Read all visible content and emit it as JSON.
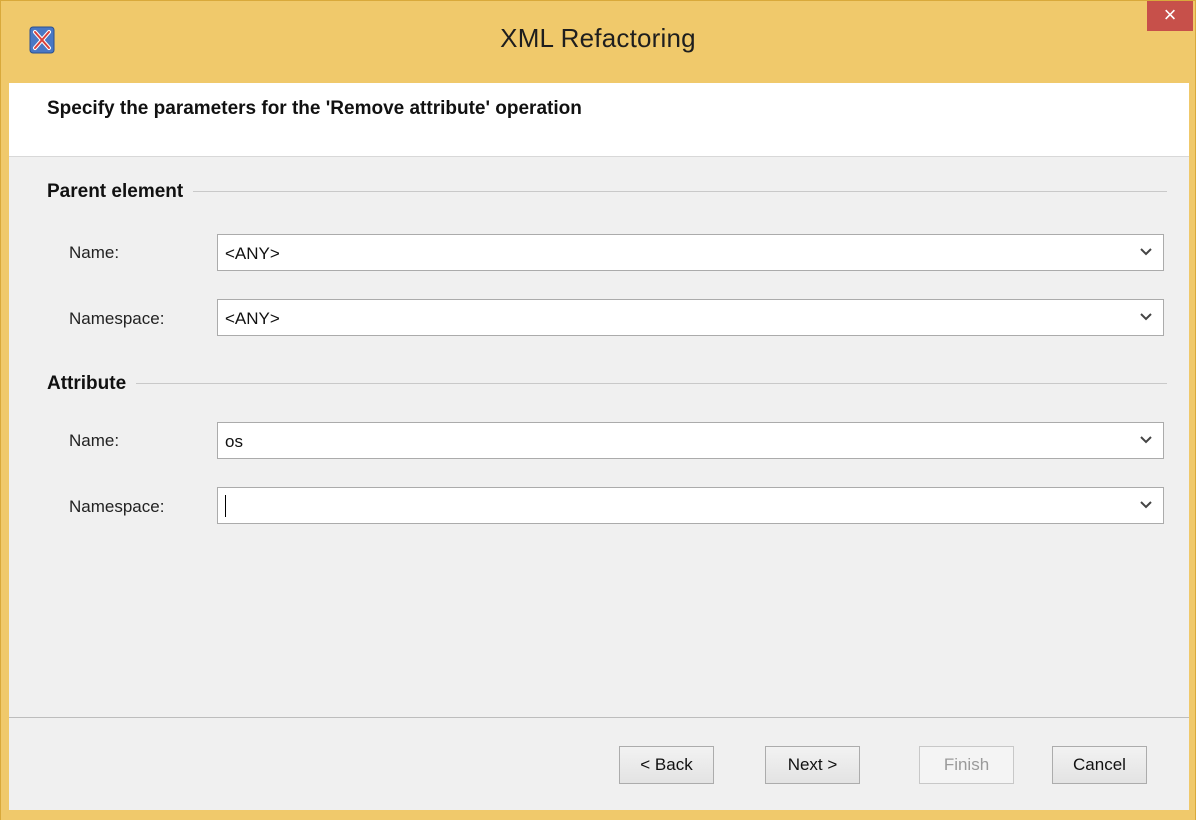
{
  "window": {
    "title": "XML Refactoring",
    "close_label": "×",
    "icon": "xml-refactoring-app-icon"
  },
  "header": {
    "text": "Specify the parameters for the 'Remove attribute' operation"
  },
  "parent_element": {
    "section_title": "Parent element",
    "name_label": "Name:",
    "name_value": "<ANY>",
    "namespace_label": "Namespace:",
    "namespace_value": "<ANY>"
  },
  "attribute": {
    "section_title": "Attribute",
    "name_label": "Name:",
    "name_value": "os",
    "namespace_label": "Namespace:",
    "namespace_value": ""
  },
  "buttons": {
    "back": "< Back",
    "next": "Next >",
    "finish": "Finish",
    "cancel": "Cancel"
  },
  "colors": {
    "title_bar": "#f0c96b",
    "close_button": "#c7504a",
    "dialog_background": "#f0f0f0"
  }
}
